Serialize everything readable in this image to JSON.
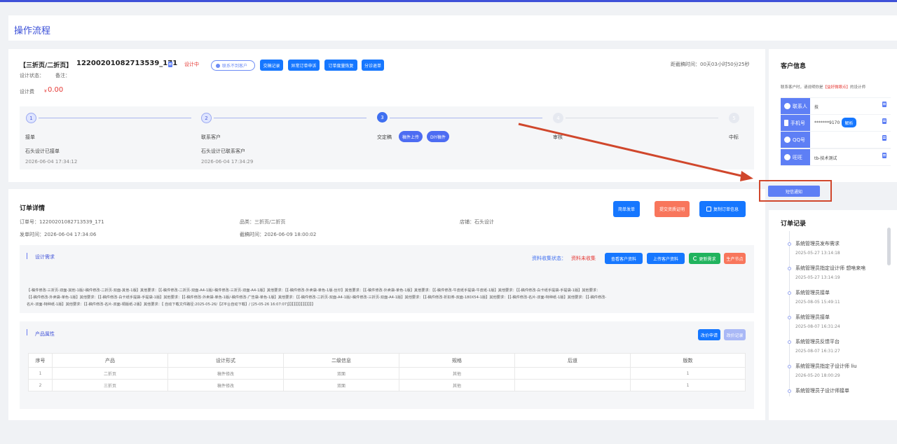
{
  "page_title": "操作流程",
  "order_header": {
    "type_label": "【三折页/二折页】",
    "order_no": "12200201082713539_171",
    "status": "设计中",
    "contact_unreachable_btn": "联系不到客户",
    "buttons": [
      "交稿记录",
      "异常订单申诉",
      "订单度量恢复",
      "分诊退单"
    ],
    "countdown": "距截稿时间：00天03小时50分25秒",
    "design_status_label": "设计状态：",
    "remark_label": "备注：",
    "design_fee_label": "设计费",
    "design_fee_currency": "¥",
    "design_fee_value": "0.00"
  },
  "steps": [
    {
      "num": "1",
      "name": "接单",
      "desc": "石头设计已接单",
      "time": "2026-06-04 17:34:12",
      "state": "done"
    },
    {
      "num": "2",
      "name": "联系客户",
      "desc": "石头设计已联系客户",
      "time": "2026-06-04 17:34:29",
      "state": "done"
    },
    {
      "num": "3",
      "name": "交定稿",
      "desc": "",
      "time": "",
      "state": "current",
      "tags": [
        "稿件上传",
        "DIY稿件"
      ]
    },
    {
      "num": "4",
      "name": "审核",
      "desc": "",
      "time": "",
      "state": "wait"
    },
    {
      "num": "5",
      "name": "中标",
      "desc": "",
      "time": "",
      "state": "wait"
    }
  ],
  "order_detail": {
    "title": "订单详情",
    "buttons": [
      "简单发单",
      "提交资质证明",
      "复制订单信息"
    ],
    "order_no_label": "订单号：",
    "order_no": "12200201082713539_171",
    "category_label": "品类：",
    "category": "三折页/二折页",
    "shop_label": "店铺：",
    "shop": "石头设计",
    "send_time_label": "发单时间：",
    "send_time": "2026-06-04 17:34:06",
    "deadline_label": "截稿时间：",
    "deadline": "2026-06-09 18:00:02"
  },
  "design_requirements": {
    "title": "设计需求",
    "collect_status_label": "资料收集状态：",
    "collect_status": "资料未收集",
    "buttons": [
      "查看客户资料",
      "上传客户资料",
      "更新需求",
      "生产节点"
    ],
    "text_lines": [
      "【-稿件修改-三折页-双面-其他-1版/-稿件修改-二折页-双面-其他-1版】其他要求：【【-稿件修改-二折页-双面-A4-1版/-稿件修改-三折页-双面-A4-1版】其他要求：【【-稿件修改-外卖袋-单色-1版-丝印】其他要求：【【-稿件修改-外卖袋-单色-1版】其他要求：【【-稿件修改-牛皮纸手提袋-牛皮纸-1版】其他要求：【【-稿件修改-白卡纸手提袋-手提袋-1版】其他要求：",
      "【【-稿件修改-外卖袋-单色-1版】其他要求：【【-稿件修改-白卡纸手提袋-手提袋-1版】其他要求：【【-稿件修改-外卖袋-单色-1版/-稿件修改-广告袋-单色-1版】其他要求：【【-稿件修改-二折页-双面-A4-1版/-稿件修改-三折页-双面-A4-1版】其他要求：【【-稿件修改-折扣券-双面-180X54-1版】其他要求：【【-稿件修改-名片-双面-特种纸-1版】其他要求：【【-稿件修改-",
      "名片-双面-特种纸-1版】其他要求：【【-稿件修改-名片-双面-铜版纸-2版】其他要求：【 自动下载文件路径:2025-05-26/【Z平台自动下载】/ [25-05-26 16:07:07]】】】】】】】】】】】】】】"
    ]
  },
  "product_attrs": {
    "title": "产品属性",
    "buttons": [
      "改价申请",
      "改价记录"
    ],
    "columns": [
      "序号",
      "产品",
      "设计形式",
      "二级信息",
      "规格",
      "后道",
      "版数"
    ],
    "rows": [
      [
        "1",
        "二折页",
        "稿件修改",
        "双面",
        "其他",
        "",
        "1"
      ],
      [
        "2",
        "三折页",
        "稿件修改",
        "双面",
        "其他",
        "",
        "1"
      ]
    ]
  },
  "customer_info": {
    "title": "客户信息",
    "note_prefix": "联系客户时，请说明你是",
    "note_highlight": "【益好微眼点】",
    "note_suffix": "的设计师",
    "rows": [
      {
        "label": "联系人",
        "value": "技",
        "icon": "user-icon"
      },
      {
        "label": "手机号",
        "value": "*******9170",
        "icon": "phone-icon",
        "action": "解析"
      },
      {
        "label": "QQ号",
        "value": "",
        "icon": "qq-icon"
      },
      {
        "label": "旺旺",
        "value": "tb-技术测试",
        "icon": "wangwang-icon"
      }
    ],
    "sms_button": "短信通知"
  },
  "order_records": {
    "title": "订单记录",
    "items": [
      {
        "text": "系统管理员发布需求",
        "time": "2025-05-27 13:14:18"
      },
      {
        "text": "系统管理员指定设计师 想啥来啥",
        "time": "2025-05-27 13:14:19"
      },
      {
        "text": "系统管理员接单",
        "time": "2025-08-05 15:49:11"
      },
      {
        "text": "系统管理员接单",
        "time": "2025-08-07 16:31:24"
      },
      {
        "text": "系统管理员反馈平台",
        "time": "2025-08-07 16:31:27"
      },
      {
        "text": "系统管理员指定子设计师 liu",
        "time": "2026-05-20 18:00:29"
      },
      {
        "text": "系统管理员子设计师接单",
        "time": ""
      }
    ]
  },
  "colors": {
    "accent": "#1677ff",
    "brand": "#3f51d8",
    "orange": "#f8765c",
    "red": "#e53935",
    "green": "#21b35e",
    "annotation": "#d0472c"
  }
}
